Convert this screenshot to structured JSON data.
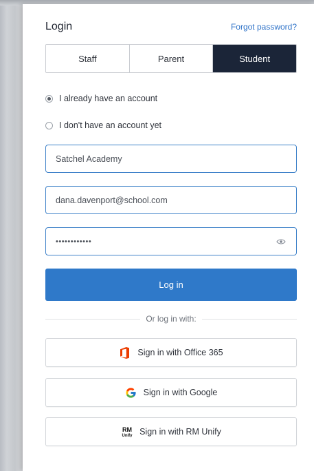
{
  "header": {
    "title": "Login",
    "forgot_link": "Forgot password?"
  },
  "tabs": [
    {
      "label": "Staff",
      "active": false
    },
    {
      "label": "Parent",
      "active": false
    },
    {
      "label": "Student",
      "active": true
    }
  ],
  "account_options": [
    {
      "label": "I already have an account",
      "checked": true
    },
    {
      "label": "I don't have an account yet",
      "checked": false
    }
  ],
  "form": {
    "school_value": "Satchel Academy",
    "email_value": "dana.davenport@school.com",
    "password_mask": "••••••••••••"
  },
  "login_button": "Log in",
  "divider_text": "Or log in with:",
  "sso": {
    "office365": "Sign in with Office 365",
    "google": "Sign in with Google",
    "rm_unify": "Sign in with RM Unify"
  },
  "colors": {
    "accent": "#2f79c9",
    "active_tab": "#1b2538",
    "link": "#2f73c8",
    "office_red": "#eb3c00"
  }
}
